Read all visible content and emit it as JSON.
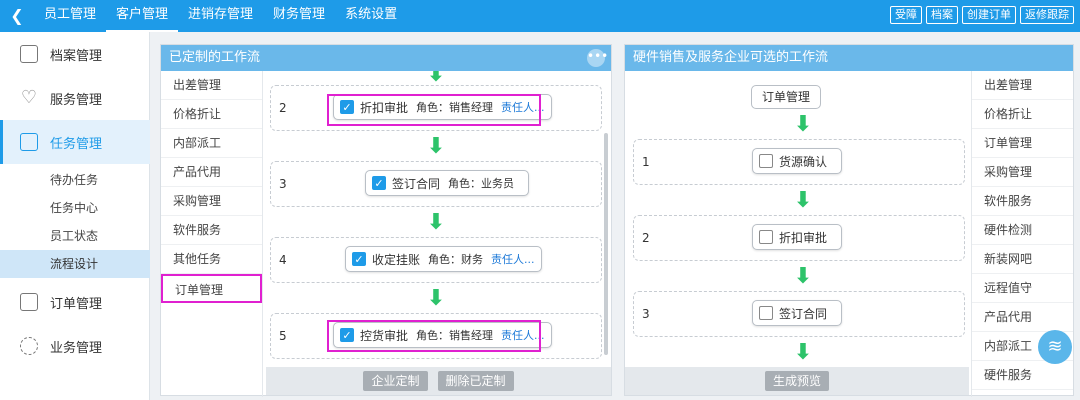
{
  "topbar": {
    "back_icon": "chevron-left-icon",
    "nav": [
      "员工管理",
      "客户管理",
      "进销存管理",
      "财务管理",
      "系统设置"
    ],
    "active_nav": "客户管理",
    "actions": [
      "受障",
      "档案",
      "创建订单",
      "返修跟踪"
    ]
  },
  "sidebar": {
    "items": [
      {
        "label": "档案管理",
        "icon": "document-icon"
      },
      {
        "label": "服务管理",
        "icon": "heart-icon"
      },
      {
        "label": "任务管理",
        "icon": "clipboard-check-icon"
      },
      {
        "label": "订单管理",
        "icon": "order-settings-icon"
      },
      {
        "label": "业务管理",
        "icon": "cycle-icon"
      }
    ],
    "active_item": "任务管理",
    "sub_items": [
      "待办任务",
      "任务中心",
      "员工状态",
      "流程设计"
    ],
    "active_sub": "流程设计"
  },
  "left_panel": {
    "title": "已定制的工作流",
    "categories": [
      "出差管理",
      "价格折让",
      "内部派工",
      "产品代用",
      "采购管理",
      "软件服务",
      "其他任务",
      "订单管理"
    ],
    "selected_category": "订单管理",
    "steps": [
      {
        "num": "2",
        "name": "折扣审批",
        "role": "角色：销售经理",
        "owner": "责任人...",
        "checked": true
      },
      {
        "num": "3",
        "name": "签订合同",
        "role": "角色：业务员",
        "owner": "",
        "checked": true
      },
      {
        "num": "4",
        "name": "收定挂账",
        "role": "角色：财务",
        "owner": "责任人...",
        "checked": true
      },
      {
        "num": "5",
        "name": "控货审批",
        "role": "角色：销售经理",
        "owner": "责任人...",
        "checked": true
      }
    ],
    "footer_buttons": [
      "企业定制",
      "删除已定制"
    ]
  },
  "right_panel": {
    "title": "硬件销售及服务企业可选的工作流",
    "start_node": "订单管理",
    "steps": [
      {
        "num": "1",
        "name": "货源确认",
        "checked": false
      },
      {
        "num": "2",
        "name": "折扣审批",
        "checked": false
      },
      {
        "num": "3",
        "name": "签订合同",
        "checked": false
      }
    ],
    "categories": [
      "出差管理",
      "价格折让",
      "订单管理",
      "采购管理",
      "软件服务",
      "硬件检测",
      "新装网吧",
      "远程值守",
      "产品代用",
      "内部派工",
      "硬件服务"
    ],
    "footer_buttons": [
      "生成预览"
    ]
  },
  "colors": {
    "primary": "#1e9be8",
    "panel_header": "#6ab8ea",
    "arrow": "#2dc36a",
    "highlight": "#e020d0"
  }
}
